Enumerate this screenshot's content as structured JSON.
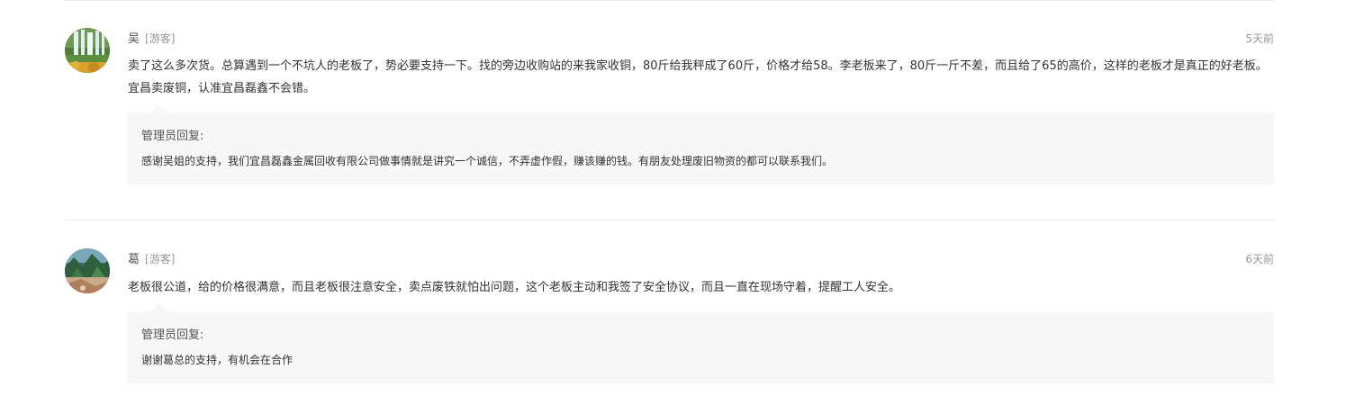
{
  "comments": [
    {
      "author": "吴",
      "tag": "[游客]",
      "time": "5天前",
      "avatar": "waterfall-avatar",
      "content": "卖了这么多次货。总算遇到一个不坑人的老板了，势必要支持一下。找的旁边收购站的来我家收铜，80斤给我秤成了60斤，价格才给58。李老板来了，80斤一斤不差，而且给了65的高价，这样的老板才是真正的好老板。宜昌卖废铜，认准宜昌磊鑫不会错。",
      "reply": {
        "label": "管理员回复:",
        "text": "感谢吴姐的支持，我们宜昌磊鑫金属回收有限公司做事情就是讲究一个诚信，不弄虚作假，赚该赚的钱。有朋友处理废旧物资的都可以联系我们。"
      }
    },
    {
      "author": "葛",
      "tag": "[游客]",
      "time": "6天前",
      "avatar": "landscape-avatar",
      "content": "老板很公道，给的价格很满意，而且老板很注意安全，卖点废铁就怕出问题，这个老板主动和我签了安全协议，而且一直在现场守着，提醒工人安全。",
      "reply": {
        "label": "管理员回复:",
        "text": "谢谢葛总的支持，有机会在合作"
      }
    }
  ]
}
